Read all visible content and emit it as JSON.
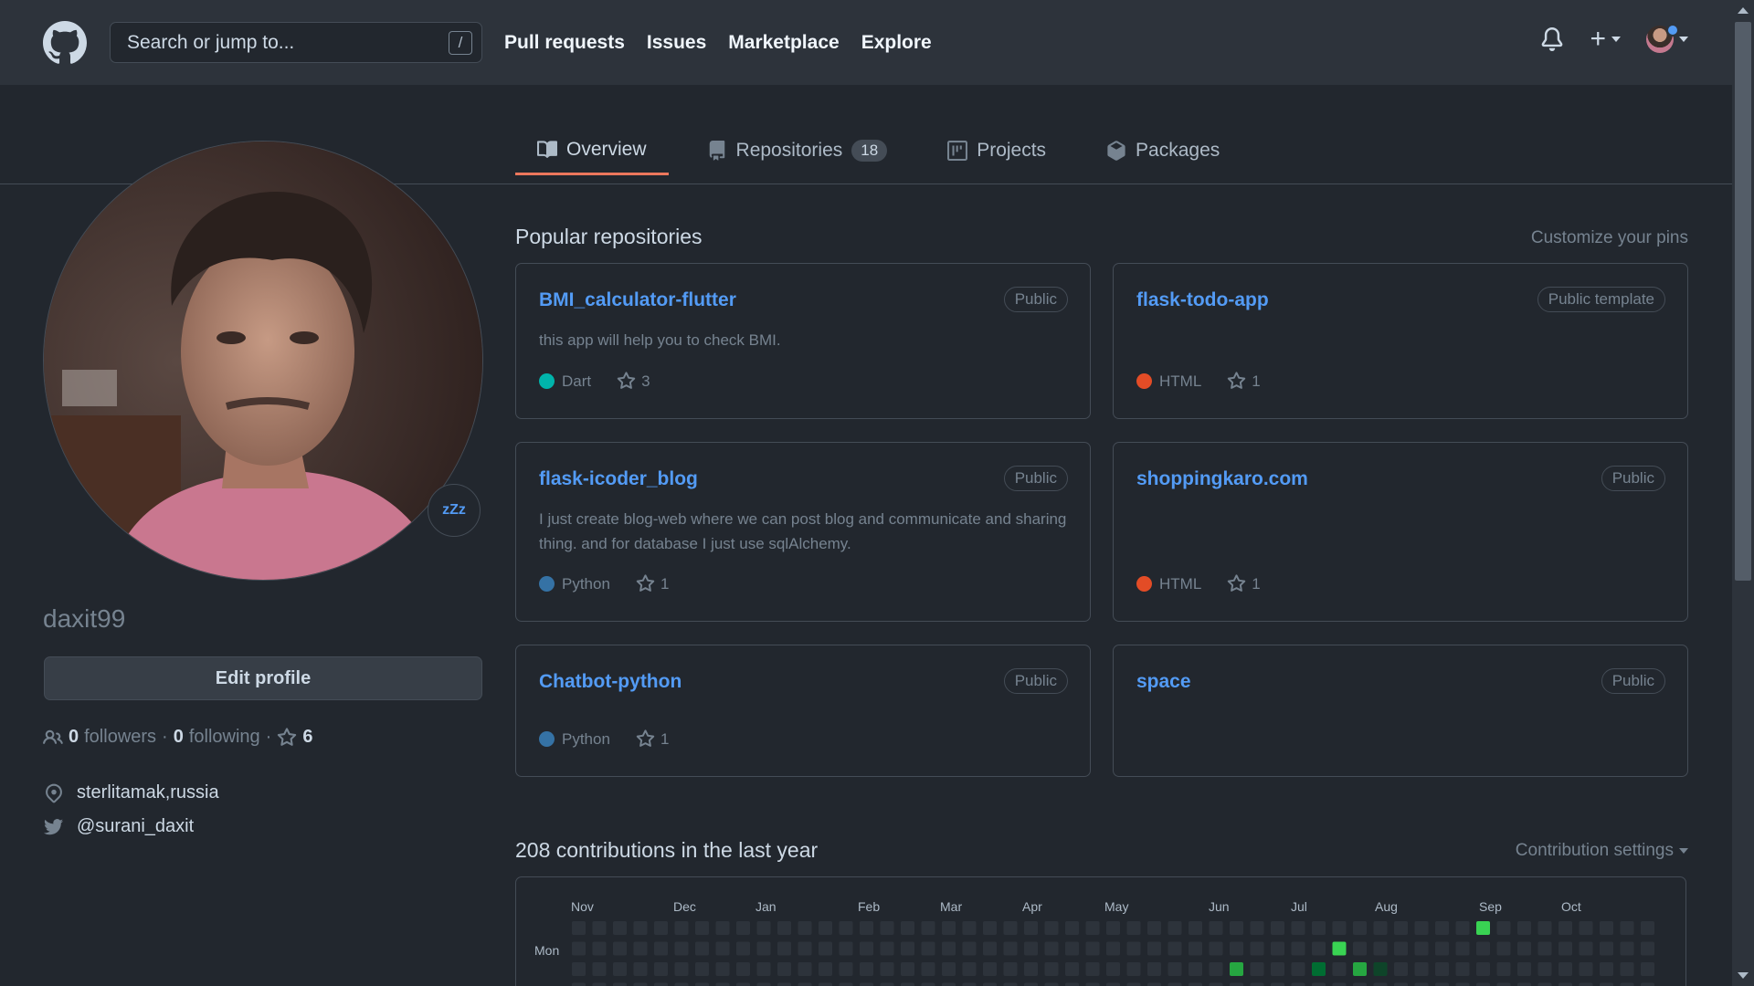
{
  "header": {
    "search_placeholder": "Search or jump to...",
    "search_shortcut": "/",
    "nav": [
      "Pull requests",
      "Issues",
      "Marketplace",
      "Explore"
    ],
    "plus_label": "+"
  },
  "tabs": [
    {
      "label": "Overview",
      "icon": "book-icon",
      "active": true
    },
    {
      "label": "Repositories",
      "icon": "repo-icon",
      "count": "18"
    },
    {
      "label": "Projects",
      "icon": "project-icon"
    },
    {
      "label": "Packages",
      "icon": "package-icon"
    }
  ],
  "profile": {
    "status_emoji": "zZz",
    "username": "daxit99",
    "edit_label": "Edit profile",
    "followers_count": "0",
    "followers_label": "followers",
    "separator": "·",
    "following_count": "0",
    "following_label": "following",
    "stars_count": "6",
    "location": "sterlitamak,russia",
    "twitter": "@surani_daxit"
  },
  "popular": {
    "title": "Popular repositories",
    "customize_label": "Customize your pins",
    "repos": [
      {
        "name": "BMI_calculator-flutter",
        "badge": "Public",
        "desc": "this app will help you to check BMI.",
        "lang": "Dart",
        "lang_color": "#00B4AB",
        "stars": "3"
      },
      {
        "name": "flask-todo-app",
        "badge": "Public template",
        "desc": "",
        "lang": "HTML",
        "lang_color": "#e34c26",
        "stars": "1"
      },
      {
        "name": "flask-icoder_blog",
        "badge": "Public",
        "desc": "I just create blog-web where we can post blog and communicate and sharing thing. and for database I just use sqlAlchemy.",
        "lang": "Python",
        "lang_color": "#3572A5",
        "stars": "1"
      },
      {
        "name": "shoppingkaro.com",
        "badge": "Public",
        "desc": "",
        "lang": "HTML",
        "lang_color": "#e34c26",
        "stars": "1"
      },
      {
        "name": "Chatbot-python",
        "badge": "Public",
        "desc": "",
        "lang": "Python",
        "lang_color": "#3572A5",
        "stars": "1"
      },
      {
        "name": "space",
        "badge": "Public",
        "desc": "",
        "lang": "",
        "lang_color": "",
        "stars": ""
      }
    ]
  },
  "contributions": {
    "title": "208 contributions in the last year",
    "settings_label": "Contribution settings",
    "months": [
      "Nov",
      "Dec",
      "Jan",
      "Feb",
      "Mar",
      "Apr",
      "May",
      "Jun",
      "Jul",
      "Aug",
      "Sep",
      "Oct"
    ],
    "day_label": "Mon",
    "colors": {
      "empty": "#2d333b",
      "l1": "#0e4429",
      "l2": "#006d32",
      "l3": "#26a641",
      "l4": "#39d353"
    }
  }
}
